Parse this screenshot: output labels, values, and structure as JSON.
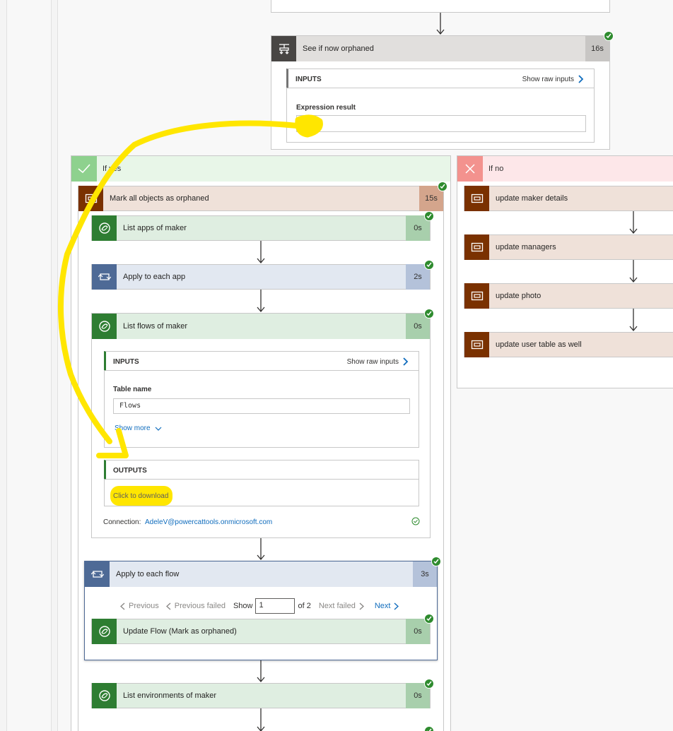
{
  "top_step": {
    "title": "See if now orphaned",
    "duration": "16s",
    "inputs_label": "INPUTS",
    "show_raw_inputs": "Show raw inputs",
    "expression_label": "Expression result",
    "expression_value": "true"
  },
  "branch_yes": {
    "label": "If yes",
    "scope": {
      "title": "Mark all objects as orphaned",
      "duration": "15s"
    },
    "steps": [
      {
        "title": "List apps of maker",
        "duration": "0s"
      },
      {
        "title": "Apply to each app",
        "duration": "2s"
      },
      {
        "title": "List flows of maker",
        "duration": "0s"
      }
    ],
    "flows_card": {
      "inputs_label": "INPUTS",
      "show_raw_inputs": "Show raw inputs",
      "table_name_label": "Table name",
      "table_name_value": "Flows",
      "show_more": "Show more",
      "outputs_label": "OUTPUTS",
      "download_link": "Click to download",
      "connection_label": "Connection:",
      "connection_value": "AdeleV@powercattools.onmicrosoft.com"
    },
    "apply_each_flow": {
      "title": "Apply to each flow",
      "duration": "3s",
      "previous": "Previous",
      "previous_failed": "Previous failed",
      "show": "Show",
      "page_value": "1",
      "of_total": "of 2",
      "next_failed": "Next failed",
      "next": "Next",
      "inner_step": {
        "title": "Update Flow (Mark as orphaned)",
        "duration": "0s"
      }
    },
    "last_step": {
      "title": "List environments of maker",
      "duration": "0s"
    }
  },
  "branch_no": {
    "label": "If no",
    "steps": [
      {
        "title": "update maker details"
      },
      {
        "title": "update managers"
      },
      {
        "title": "update photo"
      },
      {
        "title": "update user table as well"
      }
    ]
  },
  "colors": {
    "dataverse_green": "#2e7d32",
    "dataverse_bg": "#dfeee1",
    "loop_blue": "#4e6a96",
    "loop_bg": "#e2e8f1",
    "scope_brown": "#7a3100",
    "scope_bg": "#efe1d9",
    "condition_dark": "#484644",
    "yes_green": "#7fcf7f",
    "no_red": "#f3928e",
    "highlight": "#ffe600"
  }
}
